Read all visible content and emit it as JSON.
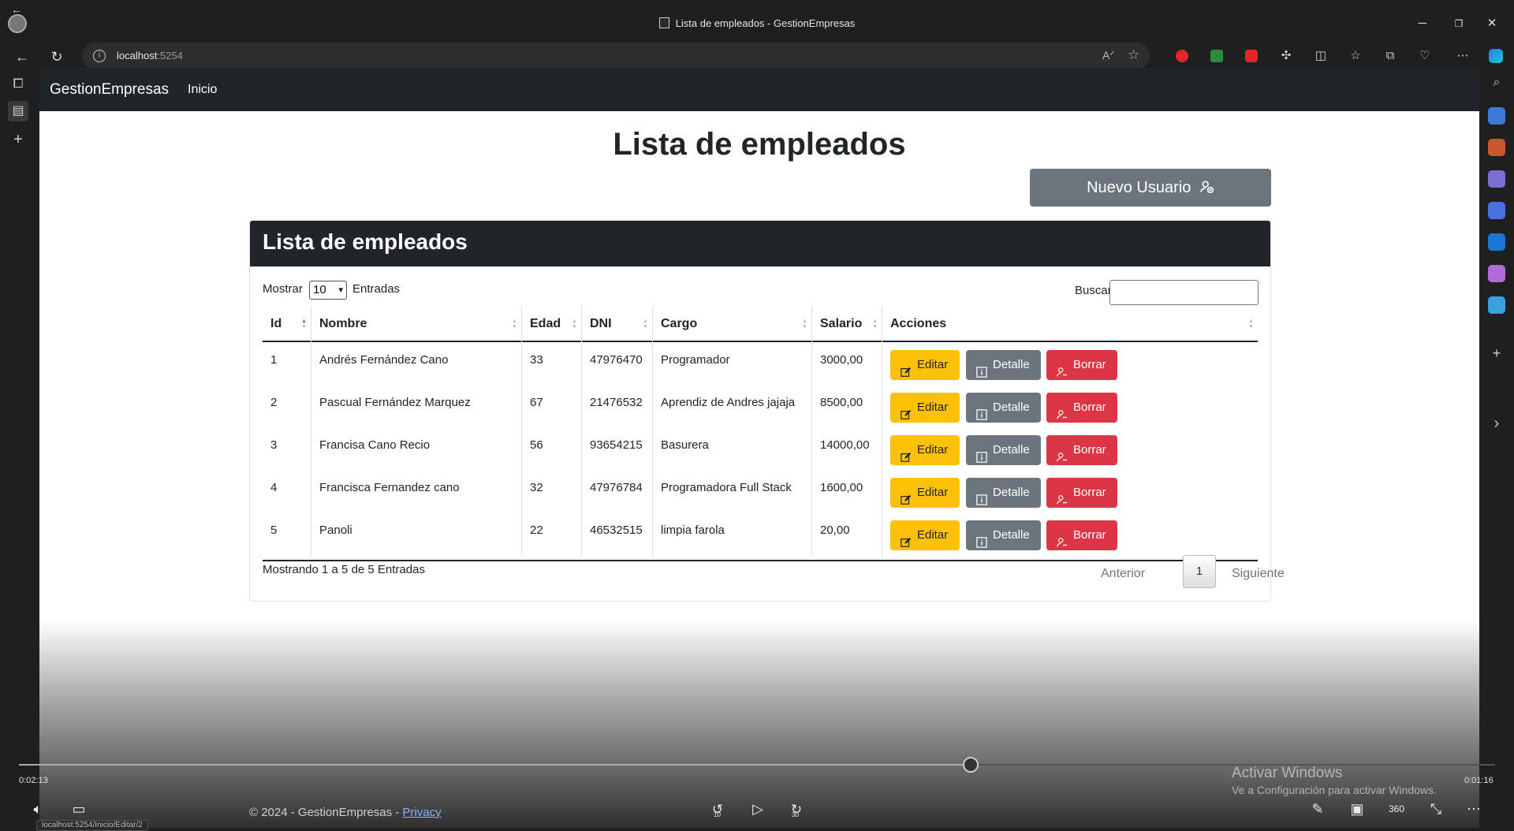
{
  "window": {
    "title": "Lista de empleados - GestionEmpresas",
    "controls": {
      "minimize": "─",
      "restore": "❐",
      "close": "✕"
    }
  },
  "browser": {
    "url_host": "localhost",
    "url_port": ":5254",
    "status_url": "localhost:5254/Inicio/Editar/2"
  },
  "app": {
    "brand": "GestionEmpresas",
    "nav_link": "Inicio"
  },
  "page": {
    "title": "Lista de empleados",
    "new_user_label": "Nuevo Usuario",
    "card_title": "Lista de empleados",
    "length_prefix": "Mostrar",
    "length_value": "10",
    "length_suffix": "Entradas",
    "search_label": "Buscar:",
    "search_value": ""
  },
  "table": {
    "columns": [
      "Id",
      "Nombre",
      "Edad",
      "DNI",
      "Cargo",
      "Salario",
      "Acciones"
    ],
    "rows": [
      {
        "id": "1",
        "nombre": "Andrés Fernández Cano",
        "edad": "33",
        "dni": "47976470",
        "cargo": "Programador",
        "salario": "3000,00"
      },
      {
        "id": "2",
        "nombre": "Pascual Fernández Marquez",
        "edad": "67",
        "dni": "21476532",
        "cargo": "Aprendiz de Andres jajaja",
        "salario": "8500,00"
      },
      {
        "id": "3",
        "nombre": "Francisa Cano Recio",
        "edad": "56",
        "dni": "93654215",
        "cargo": "Basurera",
        "salario": "14000,00"
      },
      {
        "id": "4",
        "nombre": "Francisca Fernandez cano",
        "edad": "32",
        "dni": "47976784",
        "cargo": "Programadora Full Stack",
        "salario": "1600,00"
      },
      {
        "id": "5",
        "nombre": "Panoli",
        "edad": "22",
        "dni": "46532515",
        "cargo": "limpia farola",
        "salario": "20,00"
      }
    ],
    "actions": {
      "edit": "Editar",
      "detail": "Detalle",
      "delete": "Borrar"
    }
  },
  "pagination": {
    "info": "Mostrando 1 a 5 de 5 Entradas",
    "previous": "Anterior",
    "current": "1",
    "next": "Siguiente"
  },
  "footer": {
    "text": "© 2024 - GestionEmpresas - ",
    "privacy": "Privacy"
  },
  "player": {
    "elapsed": "0:02:13",
    "remaining": "0:01:16",
    "progress": 0.645,
    "rewind_seconds": "10",
    "forward_seconds": "30"
  },
  "watermark": {
    "line1": "Activar Windows",
    "line2": "Ve a Configuración para activar Windows."
  },
  "colors": {
    "edit": "#ffc107",
    "detail": "#6c757d",
    "delete": "#dc3545",
    "navbar": "#212529"
  }
}
